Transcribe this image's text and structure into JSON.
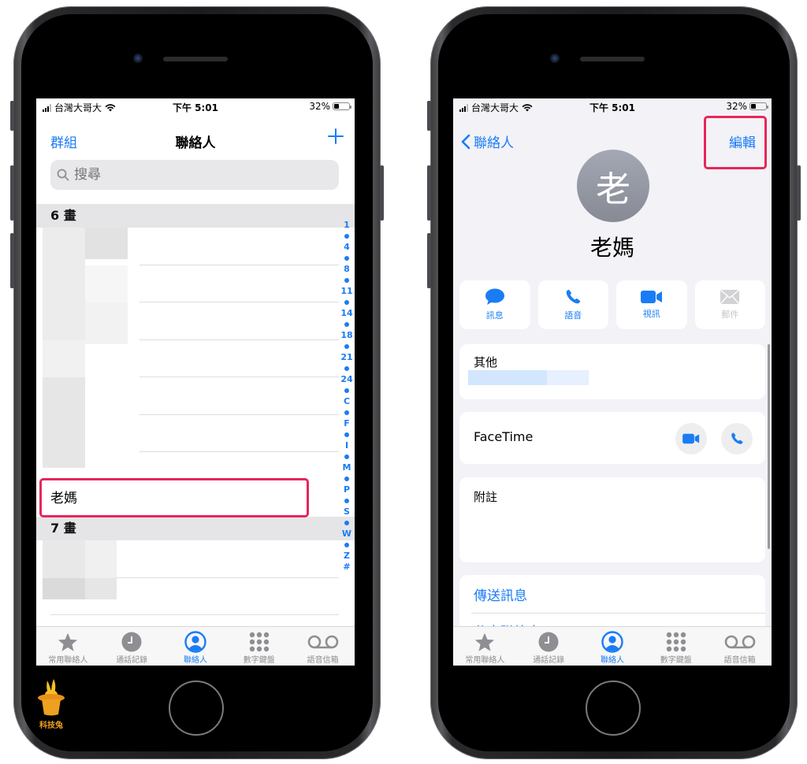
{
  "status_bar": {
    "carrier": "台灣大哥大",
    "time": "下午 5:01",
    "battery_percent": "32%",
    "battery_level": 0.32
  },
  "contacts_list": {
    "nav_left": "群組",
    "title": "聯絡人",
    "add_icon": "plus-icon",
    "search_placeholder": "搜尋",
    "sections": [
      {
        "header": "6 畫",
        "highlighted_contact": "老媽"
      },
      {
        "header": "7 畫"
      }
    ],
    "index": [
      "1",
      "4",
      "8",
      "11",
      "14",
      "18",
      "21",
      "24",
      "C",
      "F",
      "I",
      "M",
      "P",
      "S",
      "W",
      "Z",
      "#"
    ]
  },
  "contact_detail": {
    "back_label": "聯絡人",
    "edit_label": "編輯",
    "avatar_initial": "老",
    "name": "老媽",
    "actions": [
      {
        "label": "訊息",
        "icon": "message-bubble-icon",
        "enabled": true
      },
      {
        "label": "語音",
        "icon": "phone-icon",
        "enabled": true
      },
      {
        "label": "視訊",
        "icon": "video-camera-icon",
        "enabled": true
      },
      {
        "label": "郵件",
        "icon": "envelope-icon",
        "enabled": false
      }
    ],
    "other_label": "其他",
    "facetime_label": "FaceTime",
    "notes_label": "附註",
    "links": [
      "傳送訊息",
      "分享聯絡人"
    ]
  },
  "tab_bar": {
    "tabs": [
      {
        "label": "常用聯絡人",
        "icon": "star-icon",
        "active": false
      },
      {
        "label": "通話記錄",
        "icon": "clock-icon",
        "active": false
      },
      {
        "label": "聯絡人",
        "icon": "person-circle-icon",
        "active": true
      },
      {
        "label": "數字鍵盤",
        "icon": "keypad-icon",
        "active": false
      },
      {
        "label": "語音信箱",
        "icon": "voicemail-icon",
        "active": false
      }
    ]
  },
  "watermark": {
    "label": "科技兔"
  },
  "colors": {
    "accent": "#1a7cf5",
    "highlight": "#e8265a"
  }
}
